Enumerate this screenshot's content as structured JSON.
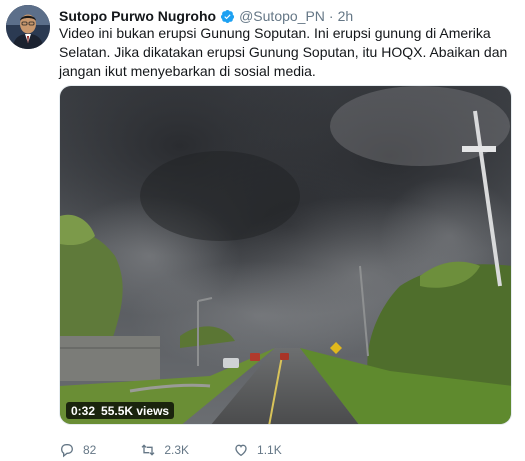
{
  "tweet": {
    "author_name": "Sutopo Purwo Nugroho",
    "handle": "@Sutopo_PN",
    "separator": "·",
    "time": "2h",
    "verified": true,
    "text": "Video ini bukan erupsi Gunung Soputan. Ini erupsi gunung di Amerika Selatan. Jika dikatakan erupsi Gunung Soputan, itu HOQX. Abaikan dan jangan ikut menyebarkan di sosial media."
  },
  "video": {
    "duration": "0:32",
    "views": "55.5K views"
  },
  "actions": {
    "replies": "82",
    "retweets": "2.3K",
    "likes": "1.1K"
  },
  "icons": {
    "verified": "verified-badge-icon",
    "reply": "reply-icon",
    "retweet": "retweet-icon",
    "like": "heart-icon"
  },
  "colors": {
    "accent": "#1da1f2",
    "text": "#14171a",
    "muted": "#657786"
  }
}
